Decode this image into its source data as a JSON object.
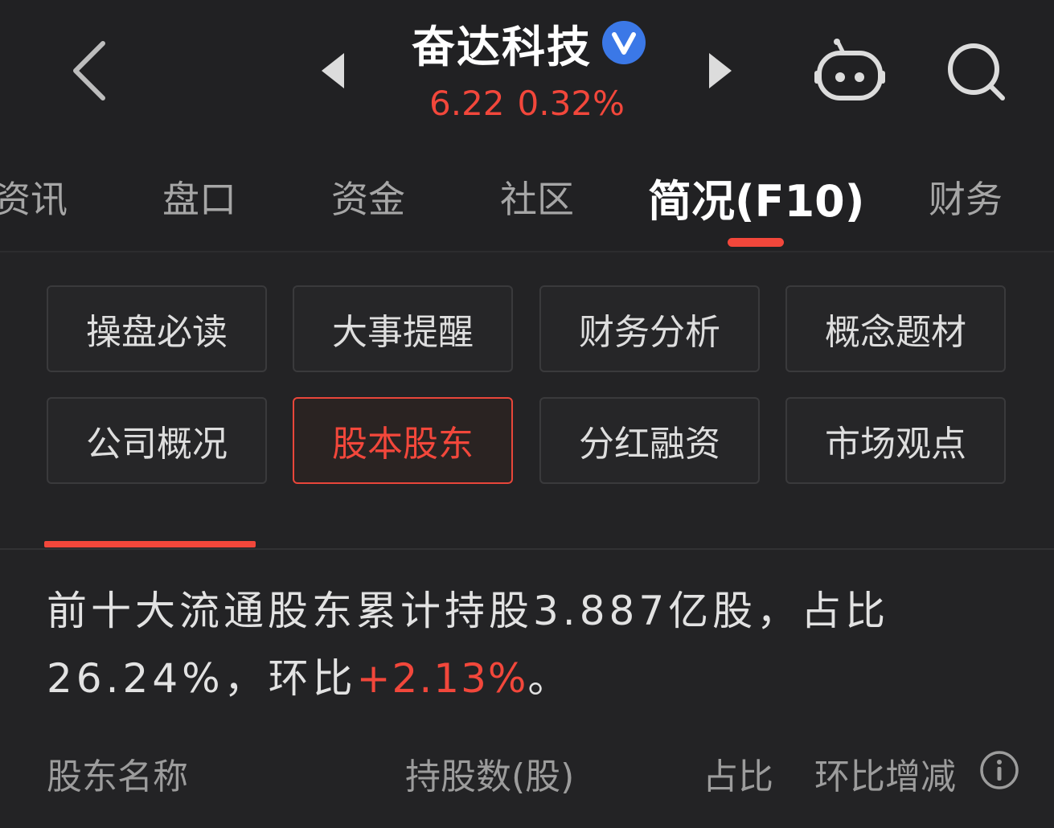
{
  "header": {
    "stock_name": "奋达科技",
    "price": "6.22",
    "change_pct": "0.32%",
    "icons": [
      "back-icon",
      "prev-stock-icon",
      "verified-icon",
      "next-stock-icon",
      "robot-assistant-icon",
      "search-icon"
    ]
  },
  "tabs": [
    {
      "label": "资讯"
    },
    {
      "label": "盘口"
    },
    {
      "label": "资金"
    },
    {
      "label": "社区"
    },
    {
      "label": "简况(F10)",
      "active": true
    },
    {
      "label": "财务"
    }
  ],
  "sections": [
    {
      "label": "操盘必读"
    },
    {
      "label": "大事提醒"
    },
    {
      "label": "财务分析"
    },
    {
      "label": "概念题材"
    },
    {
      "label": "公司概况"
    },
    {
      "label": "股本股东",
      "selected": true
    },
    {
      "label": "分红融资"
    },
    {
      "label": "市场观点"
    }
  ],
  "summary": {
    "text_part1": "前十大流通股东累计持股3.887亿股，占比26.24%，环比",
    "change": "+2.13%",
    "text_end": "。"
  },
  "table": {
    "columns": {
      "name": "股东名称",
      "shares": "持股数(股)",
      "ratio": "占比",
      "change": "环比增减"
    }
  },
  "colors": {
    "accent": "#f2473b",
    "background": "#232325",
    "text": "#e2e2e2"
  }
}
